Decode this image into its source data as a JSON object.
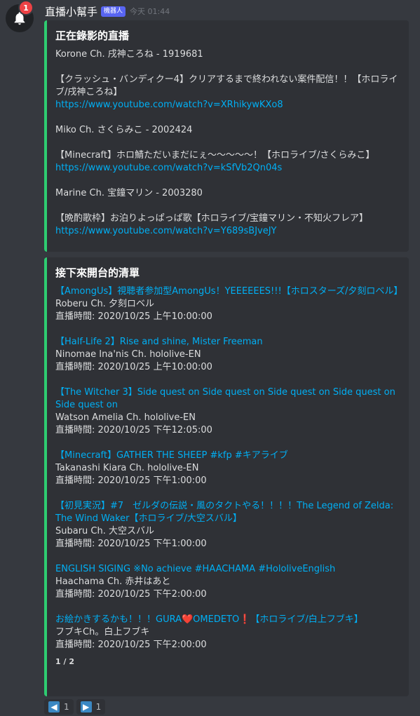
{
  "message": {
    "username": "直播小幫手",
    "bot_tag": "機器人",
    "timestamp": "今天 01:44",
    "notification_count": "1"
  },
  "live_embed": {
    "title": "正在錄影的直播",
    "items": [
      {
        "channel": "Korone Ch. 戌神ころね - 1919681",
        "title": "【クラッシュ・バンディクー4】クリアするまで終われない案件配信！！【ホロライブ/戌神ころね】",
        "url": "https://www.youtube.com/watch?v=XRhikywKXo8"
      },
      {
        "channel": "Miko Ch. さくらみこ - 2002424",
        "title": "【Minecraft】ホロ鯖ただいまだにぇ～～～～～！【ホロライブ/さくらみこ】",
        "url": "https://www.youtube.com/watch?v=kSfVb2Qn04s"
      },
      {
        "channel": "Marine Ch. 宝鐘マリン - 2003280",
        "title": "【晩酌歌枠】お泊りよっぱっぱ歌【ホロライブ/宝鐘マリン・不知火フレア】",
        "url": "https://www.youtube.com/watch?v=Y689sBJveJY"
      }
    ]
  },
  "upcoming_embed": {
    "title": "接下來開台的清單",
    "items": [
      {
        "title": "【AmongUs】視聴者参加型AmongUs！YEEEEEES!!!【ホロスターズ/夕刻ロベル】",
        "channel": "Roberu Ch. 夕刻ロベル",
        "time": "直播時間: 2020/10/25 上午10:00:00"
      },
      {
        "title": "【Half-Life 2】Rise and shine, Mister Freeman",
        "channel": "Ninomae Ina'nis Ch. hololive-EN",
        "time": "直播時間: 2020/10/25 上午10:00:00"
      },
      {
        "title": "【The Witcher 3】Side quest on Side quest on Side quest on Side quest on Side quest on",
        "channel": "Watson Amelia Ch. hololive-EN",
        "time": "直播時間: 2020/10/25 下午12:05:00"
      },
      {
        "title": "【Minecraft】GATHER THE SHEEP #kfp #キアライブ",
        "channel": "Takanashi Kiara Ch. hololive-EN",
        "time": "直播時間: 2020/10/25 下午1:00:00"
      },
      {
        "title": "【初見実況】#7　ゼルダの伝説・風のタクトやる！！！！The Legend of Zelda: The Wind Waker【ホロライブ/大空スバル】",
        "channel": "Subaru Ch. 大空スバル",
        "time": "直播時間: 2020/10/25 下午1:00:00"
      },
      {
        "title": "ENGLISH SIGING ※No achieve #HAACHAMA #HololiveEnglish",
        "channel": "Haachama Ch. 赤井はあと",
        "time": "直播時間: 2020/10/25 下午2:00:00"
      },
      {
        "title": "お絵かきするかも！！！GURA❤️OMEDETO❗【ホロライブ/白上フブキ】",
        "channel": "フブキCh。白上フブキ",
        "time": "直播時間: 2020/10/25 下午2:00:00"
      }
    ],
    "footer": "1 / 2"
  },
  "reactions": [
    {
      "emoji": "left-arrow-icon",
      "glyph": "◀",
      "count": "1"
    },
    {
      "emoji": "right-arrow-icon",
      "glyph": "▶",
      "count": "1"
    }
  ],
  "colors": {
    "embed_accent": "#2ecc71",
    "link": "#00aff4",
    "bot_tag": "#5865f2"
  }
}
